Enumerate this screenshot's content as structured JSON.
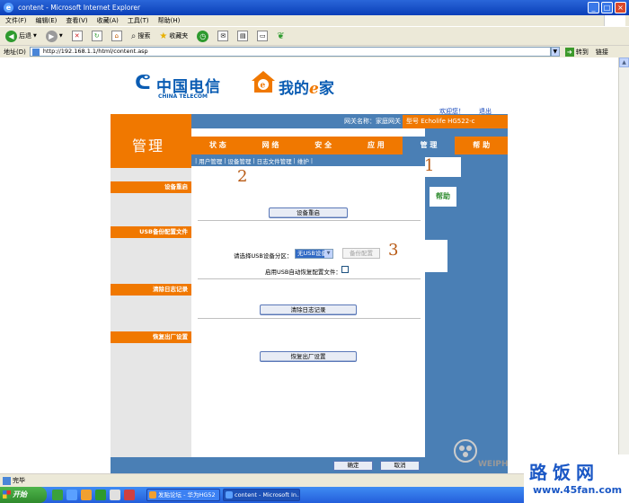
{
  "window": {
    "title": "content - Microsoft Internet Explorer",
    "minimize": "_",
    "maximize": "□",
    "close": "×"
  },
  "menu": [
    "文件(F)",
    "编辑(E)",
    "查看(V)",
    "收藏(A)",
    "工具(T)",
    "帮助(H)"
  ],
  "toolbar": {
    "back": "后退",
    "search": "搜索",
    "favorites": "收藏夹"
  },
  "address": {
    "label": "地址(D)",
    "url": "http://192.168.1.1/html/content.asp",
    "go": "转到",
    "links": "链接"
  },
  "page": {
    "logo_cn": "中国电信",
    "logo_en": "CHINA TELECOM",
    "ehome_prefix": "我的",
    "ehome_e": "e",
    "ehome_suffix": "家",
    "top_link_1": "欢迎您！",
    "top_link_2": "退出",
    "gateway_name": "网关名称：家庭网关",
    "model": "型号  Echolife HG522-c",
    "header_title": "管理",
    "nav_tabs": [
      "状 态",
      "网 络",
      "安 全",
      "应 用",
      "管 理",
      "帮 助"
    ],
    "active_tab": 4,
    "subnav": [
      "用户管理",
      "设备管理",
      "日志文件管理",
      "维护"
    ],
    "sections": {
      "reboot": "设备重启",
      "usb_backup": "USB备份配置文件",
      "clear_log": "清除日志记录",
      "factory": "恢复出厂设置"
    },
    "help": "帮助",
    "markers": [
      "1",
      "2",
      "3"
    ],
    "buttons": {
      "reboot": "设备重启",
      "backup": "备份配置",
      "clear_log": "清除日志记录",
      "factory": "恢复出厂设置",
      "ok": "确定",
      "cancel": "取消"
    },
    "usb_select_label": "请选择USB设备分区：",
    "usb_select_value": "无USB设备",
    "usb_auto_label": "启用USB自动恢复配置文件：",
    "watermark": "WEIPH"
  },
  "status": {
    "text": "完毕"
  },
  "taskbar": {
    "start": "开始",
    "items": [
      "发贴论坛 - 华为HG52",
      "content - Microsoft In..."
    ]
  },
  "brand": {
    "cn": "路饭网",
    "url": "www.45fan.com"
  },
  "colors": {
    "orange": "#f07800",
    "blue_panel": "#4a7fb5",
    "xp_blue": "#245edb"
  }
}
